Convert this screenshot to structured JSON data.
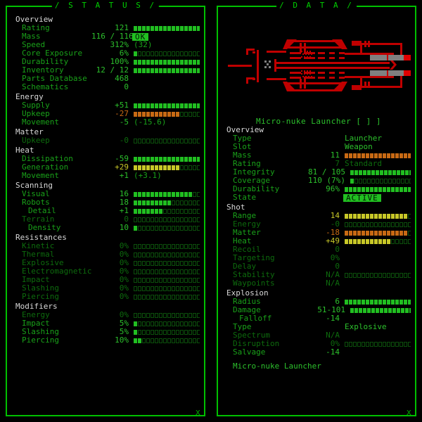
{
  "panels": {
    "status": {
      "title": "/ S T A T U S /",
      "close_icon": "x",
      "groups": [
        {
          "name": "Overview",
          "rows": [
            {
              "label": "Rating",
              "value": "121",
              "bar": {
                "fill": 16,
                "total": 22,
                "color": "green"
              }
            },
            {
              "label": "Mass",
              "value": "116 / 116",
              "tag": "OK"
            },
            {
              "label": "Speed",
              "value": "312%",
              "text": "(32)",
              "text_style": "paren"
            },
            {
              "label": "Core Exposure",
              "value": "6%",
              "bar": {
                "fill": 1,
                "total": 22,
                "color": "green"
              }
            },
            {
              "label": "Durability",
              "value": "100%",
              "bar": {
                "fill": 22,
                "total": 22,
                "color": "green"
              }
            },
            {
              "label": "Inventory",
              "value": "12 / 12",
              "bar": {
                "fill": 22,
                "total": 22,
                "color": "green"
              }
            },
            {
              "label": "Parts Database",
              "value": "468"
            },
            {
              "label": "Schematics",
              "value": "0"
            }
          ]
        },
        {
          "name": "Energy",
          "rows": [
            {
              "label": "Supply",
              "value": "+51",
              "bar": {
                "fill": 22,
                "total": 22,
                "color": "green"
              }
            },
            {
              "label": "Upkeep",
              "value": "-27",
              "value_color": "orange",
              "bar": {
                "fill": 11,
                "total": 22,
                "color": "orange"
              }
            },
            {
              "label": "Movement",
              "value": "-5",
              "text": "(-15.6)",
              "text_style": "paren"
            }
          ]
        },
        {
          "name": "Matter",
          "rows": [
            {
              "label": "Upkeep",
              "label_dim": true,
              "value": "-0",
              "value_dim": true,
              "bar": {
                "fill": 0,
                "total": 22,
                "color": "green"
              }
            }
          ]
        },
        {
          "name": "Heat",
          "rows": [
            {
              "label": "Dissipation",
              "value": "-59",
              "bar": {
                "fill": 22,
                "total": 22,
                "color": "green"
              }
            },
            {
              "label": "Generation",
              "value": "+29",
              "value_color": "yellow",
              "bar": {
                "fill": 11,
                "total": 22,
                "color": "yellow"
              }
            },
            {
              "label": "Movement",
              "value": "+1",
              "text": "(+3.1)",
              "text_style": "paren"
            }
          ]
        },
        {
          "name": "Scanning",
          "rows": [
            {
              "label": "Visual",
              "value": "16",
              "bar": {
                "fill": 14,
                "total": 22,
                "color": "green"
              }
            },
            {
              "label": "Robots",
              "value": "18",
              "bar": {
                "fill": 9,
                "total": 22,
                "color": "green"
              }
            },
            {
              "label": "Detail",
              "indent": true,
              "value": "+1",
              "bar": {
                "fill": 7,
                "total": 22,
                "color": "green"
              }
            },
            {
              "label": "Terrain",
              "label_dim": true,
              "value": "0",
              "value_dim": true,
              "bar": {
                "fill": 0,
                "total": 22,
                "color": "green"
              }
            },
            {
              "label": "Density",
              "indent": true,
              "value": "10",
              "bar": {
                "fill": 1,
                "total": 22,
                "color": "green"
              }
            }
          ]
        },
        {
          "name": "Resistances",
          "rows": [
            {
              "label": "Kinetic",
              "label_dim": true,
              "value": "0%",
              "value_dim": true,
              "bar": {
                "fill": 0,
                "total": 22,
                "color": "green"
              }
            },
            {
              "label": "Thermal",
              "label_dim": true,
              "value": "0%",
              "value_dim": true,
              "bar": {
                "fill": 0,
                "total": 22,
                "color": "green"
              }
            },
            {
              "label": "Explosive",
              "label_dim": true,
              "value": "0%",
              "value_dim": true,
              "bar": {
                "fill": 0,
                "total": 22,
                "color": "green"
              }
            },
            {
              "label": "Electromagnetic",
              "label_dim": true,
              "value": "0%",
              "value_dim": true,
              "bar": {
                "fill": 0,
                "total": 22,
                "color": "green"
              }
            },
            {
              "label": "Impact",
              "label_dim": true,
              "value": "0%",
              "value_dim": true,
              "bar": {
                "fill": 0,
                "total": 22,
                "color": "green"
              }
            },
            {
              "label": "Slashing",
              "label_dim": true,
              "value": "0%",
              "value_dim": true,
              "bar": {
                "fill": 0,
                "total": 22,
                "color": "green"
              }
            },
            {
              "label": "Piercing",
              "label_dim": true,
              "value": "0%",
              "value_dim": true,
              "bar": {
                "fill": 0,
                "total": 22,
                "color": "green"
              }
            }
          ]
        },
        {
          "name": "Modifiers",
          "rows": [
            {
              "label": "Energy",
              "label_dim": true,
              "value": "0%",
              "value_dim": true,
              "bar": {
                "fill": 0,
                "total": 22,
                "color": "green"
              }
            },
            {
              "label": "Impact",
              "value": "5%",
              "bar": {
                "fill": 1,
                "total": 22,
                "color": "green"
              }
            },
            {
              "label": "Slashing",
              "value": "5%",
              "bar": {
                "fill": 1,
                "total": 22,
                "color": "green"
              }
            },
            {
              "label": "Piercing",
              "value": "10%",
              "bar": {
                "fill": 2,
                "total": 22,
                "color": "green"
              }
            }
          ]
        }
      ]
    },
    "data": {
      "title": "/ D A T A /",
      "close_icon": "x",
      "art_name": "micro-nuke-launcher-schematic",
      "item_title": "Micro-nuke Launcher [ ] ]",
      "footer_name": "Micro-nuke Launcher",
      "groups": [
        {
          "name": "Overview",
          "rows": [
            {
              "label": "Type",
              "text": "Launcher"
            },
            {
              "label": "Slot",
              "text": "Weapon"
            },
            {
              "label": "Mass",
              "value": "11",
              "bar": {
                "fill": 16,
                "total": 22,
                "color": "orange"
              }
            },
            {
              "label": "Rating",
              "value": "7",
              "value_dim": true,
              "text": "Standard",
              "text_dim": true
            },
            {
              "label": "Integrity",
              "value": "81 / 105",
              "value_wide": true,
              "bar": {
                "fill": 16,
                "total": 22,
                "color": "green"
              }
            },
            {
              "label": "Coverage",
              "value": "110 (7%)",
              "value_wide": true,
              "bar": {
                "fill": 1,
                "total": 22,
                "color": "green"
              }
            },
            {
              "label": "Durability",
              "value": "96%",
              "bar": {
                "fill": 21,
                "total": 22,
                "color": "green"
              }
            },
            {
              "label": "State",
              "tag": "ACTIVE"
            }
          ]
        },
        {
          "name": "Shot",
          "rows": [
            {
              "label": "Range",
              "value": "14",
              "value_color": "yellow",
              "bar": {
                "fill": 15,
                "total": 22,
                "color": "yellow"
              }
            },
            {
              "label": "Energy",
              "label_dim": true,
              "value": "-0",
              "value_dim": true,
              "bar": {
                "fill": 0,
                "total": 22,
                "color": "green"
              }
            },
            {
              "label": "Matter",
              "value": "-18",
              "value_color": "orange",
              "bar": {
                "fill": 15,
                "total": 22,
                "color": "orange"
              }
            },
            {
              "label": "Heat",
              "value": "+49",
              "value_color": "yellow",
              "bar": {
                "fill": 11,
                "total": 22,
                "color": "yellow"
              }
            },
            {
              "label": "Recoil",
              "label_dim": true,
              "value": "0",
              "value_dim": true
            },
            {
              "label": "Targeting",
              "label_dim": true,
              "value": "0%",
              "value_dim": true
            },
            {
              "label": "Delay",
              "label_dim": true,
              "value": "0",
              "value_dim": true
            },
            {
              "label": "Stability",
              "label_dim": true,
              "value": "N/A",
              "value_dim": true,
              "bar": {
                "fill": 0,
                "total": 22,
                "color": "green"
              }
            },
            {
              "label": "Waypoints",
              "label_dim": true,
              "value": "N/A",
              "value_dim": true
            }
          ]
        },
        {
          "name": "Explosion",
          "rows": [
            {
              "label": "Radius",
              "value": "6",
              "bar": {
                "fill": 16,
                "total": 22,
                "color": "green"
              }
            },
            {
              "label": "Damage",
              "value": "51-101",
              "value_wide": true,
              "bar": {
                "fill": 16,
                "total": 22,
                "color": "green"
              }
            },
            {
              "label": "Falloff",
              "indent": true,
              "value": "-14"
            },
            {
              "label": "Type",
              "text": "Explosive"
            },
            {
              "label": "Spectrum",
              "label_dim": true,
              "value": "N/A",
              "value_dim": true
            },
            {
              "label": "Disruption",
              "label_dim": true,
              "value": "0%",
              "value_dim": true,
              "bar": {
                "fill": 0,
                "total": 22,
                "color": "green"
              }
            },
            {
              "label": "Salvage",
              "value": "-14"
            }
          ]
        }
      ]
    }
  },
  "colors": {
    "frame": "#00c000",
    "green": "#21bf21",
    "orange": "#c86a14",
    "yellow": "#c8c828",
    "dim": "#0d6b0d",
    "art_red": "#c00000",
    "art_grey": "#808080",
    "background": "#000000"
  }
}
